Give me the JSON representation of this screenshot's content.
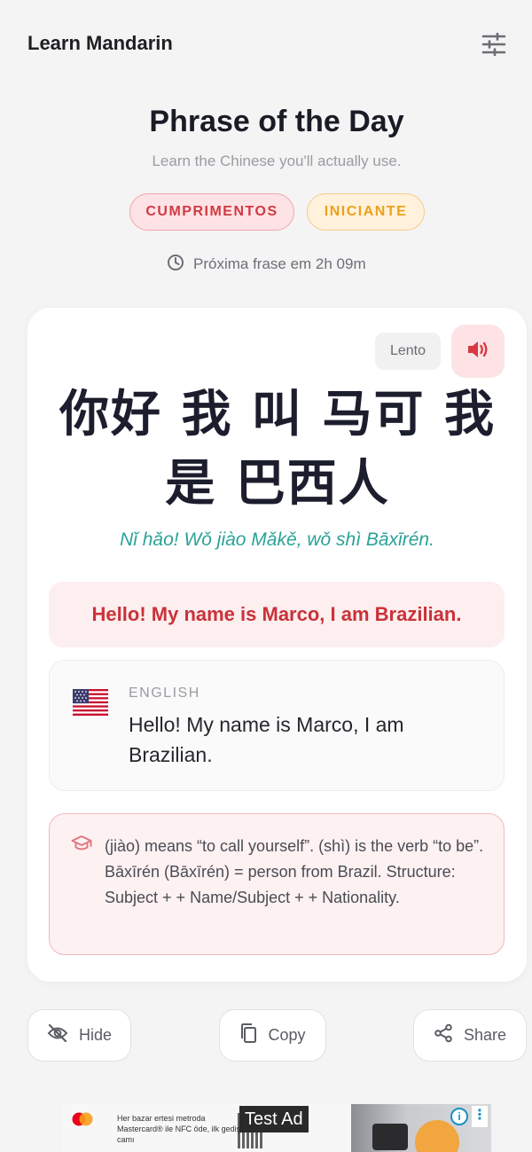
{
  "app": {
    "title": "Learn Mandarin",
    "settings_icon": "sliders-icon"
  },
  "header": {
    "title": "Phrase of the Day",
    "subtitle": "Learn the Chinese you'll actually use.",
    "category_tag": "CUMPRIMENTOS",
    "level_tag": "INICIANTE",
    "next_phrase": "Próxima frase em 2h 09m",
    "clock_icon": "clock-icon"
  },
  "phrase": {
    "slow_label": "Lento",
    "audio_icon": "speaker-icon",
    "hanzi": "你好 我 叫 马可 我 是 巴西人",
    "pinyin": "Nǐ hǎo! Wǒ jiào Mǎkě, wǒ shì Bāxīrén.",
    "translation": "Hello! My name is Marco, I am Brazilian."
  },
  "language": {
    "flag_icon": "us-flag-icon",
    "label": "ENGLISH",
    "text": "Hello! My name is Marco, I am Brazilian."
  },
  "note": {
    "icon": "graduation-cap-icon",
    "text": "(jiào) means “to call yourself”. (shì) is the verb “to be”. Bāxīrén (Bāxīrén) = person from Brazil. Structure: Subject + + Name/Subject + + Nationality."
  },
  "actions": {
    "hide_label": "Hide",
    "copy_label": "Copy",
    "share_label": "Share"
  },
  "ad": {
    "badge": "Test Ad",
    "copy": "Her bazar ertesi metroda Mastercard® ile NFC öde, ilk gedişin camı"
  },
  "colors": {
    "accent_red": "#d03a44",
    "accent_amber": "#e9a21a",
    "pinyin_teal": "#2aa296"
  }
}
